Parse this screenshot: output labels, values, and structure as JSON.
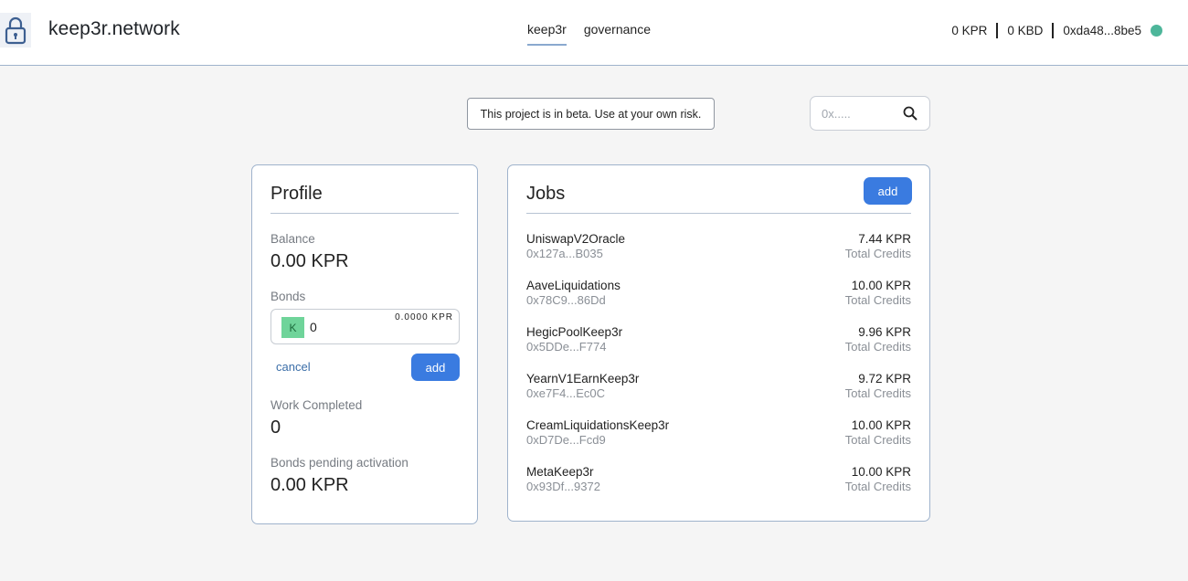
{
  "header": {
    "brand": "keep3r.network",
    "tabs": [
      {
        "label": "keep3r",
        "active": true
      },
      {
        "label": "governance",
        "active": false
      }
    ],
    "wallet": {
      "kpr_balance": "0 KPR",
      "kbd_balance": "0 KBD",
      "address": "0xda48...8be5",
      "status_color": "#4db69a"
    }
  },
  "notice": "This project is in beta. Use at your own risk.",
  "search": {
    "placeholder": "0x....."
  },
  "profile": {
    "title": "Profile",
    "balance_label": "Balance",
    "balance_value": "0.00 KPR",
    "bonds_label": "Bonds",
    "bond_token": "K",
    "bond_amount": "0",
    "bond_max": "0.0000 KPR",
    "cancel_label": "cancel",
    "add_label": "add",
    "work_label": "Work Completed",
    "work_value": "0",
    "pending_label": "Bonds pending activation",
    "pending_value": "0.00 KPR"
  },
  "jobs": {
    "title": "Jobs",
    "add_label": "add",
    "items": [
      {
        "name": "UniswapV2Oracle",
        "address": "0x127a...B035",
        "credits": "7.44 KPR",
        "credits_label": "Total Credits"
      },
      {
        "name": "AaveLiquidations",
        "address": "0x78C9...86Dd",
        "credits": "10.00 KPR",
        "credits_label": "Total Credits"
      },
      {
        "name": "HegicPoolKeep3r",
        "address": "0x5DDe...F774",
        "credits": "9.96 KPR",
        "credits_label": "Total Credits"
      },
      {
        "name": "YearnV1EarnKeep3r",
        "address": "0xe7F4...Ec0C",
        "credits": "9.72 KPR",
        "credits_label": "Total Credits"
      },
      {
        "name": "CreamLiquidationsKeep3r",
        "address": "0xD7De...Fcd9",
        "credits": "10.00 KPR",
        "credits_label": "Total Credits"
      },
      {
        "name": "MetaKeep3r",
        "address": "0x93Df...9372",
        "credits": "10.00 KPR",
        "credits_label": "Total Credits"
      }
    ]
  },
  "colors": {
    "accent": "#3a7be0",
    "border": "#9fb3cc",
    "background": "#f5f5f5"
  }
}
